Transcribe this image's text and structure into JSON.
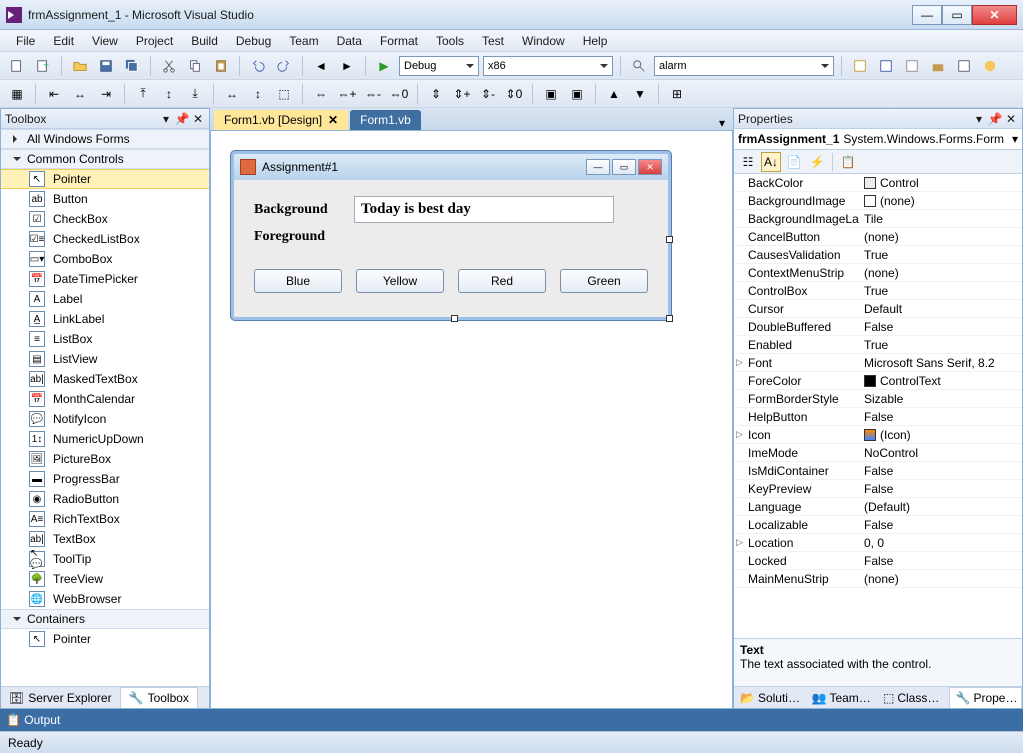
{
  "window": {
    "title": "frmAssignment_1 - Microsoft Visual Studio"
  },
  "menu": [
    "File",
    "Edit",
    "View",
    "Project",
    "Build",
    "Debug",
    "Team",
    "Data",
    "Format",
    "Tools",
    "Test",
    "Window",
    "Help"
  ],
  "toolbar": {
    "config": "Debug",
    "platform": "x86",
    "search": "alarm"
  },
  "toolbox": {
    "title": "Toolbox",
    "groups": {
      "allforms": "All Windows Forms",
      "common": "Common Controls",
      "containers": "Containers"
    },
    "common_items": [
      "Pointer",
      "Button",
      "CheckBox",
      "CheckedListBox",
      "ComboBox",
      "DateTimePicker",
      "Label",
      "LinkLabel",
      "ListBox",
      "ListView",
      "MaskedTextBox",
      "MonthCalendar",
      "NotifyIcon",
      "NumericUpDown",
      "PictureBox",
      "ProgressBar",
      "RadioButton",
      "RichTextBox",
      "TextBox",
      "ToolTip",
      "TreeView",
      "WebBrowser"
    ],
    "container_items": [
      "Pointer"
    ],
    "bottom_tabs": {
      "server": "Server Explorer",
      "toolbox": "Toolbox"
    }
  },
  "docs": {
    "tab1": "Form1.vb [Design]",
    "tab2": "Form1.vb"
  },
  "form": {
    "title": "Assignment#1",
    "label_bg": "Background",
    "label_fg": "Foreground",
    "textbox": "Today is best day",
    "buttons": [
      "Blue",
      "Yellow",
      "Red",
      "Green"
    ]
  },
  "properties": {
    "title": "Properties",
    "selected_name": "frmAssignment_1",
    "selected_type": "System.Windows.Forms.Form",
    "rows": [
      {
        "name": "BackColor",
        "value": "Control",
        "swatch": "#ececec"
      },
      {
        "name": "BackgroundImage",
        "value": "(none)",
        "swatch": "#ffffff"
      },
      {
        "name": "BackgroundImageLa",
        "value": "Tile"
      },
      {
        "name": "CancelButton",
        "value": "(none)"
      },
      {
        "name": "CausesValidation",
        "value": "True"
      },
      {
        "name": "ContextMenuStrip",
        "value": "(none)"
      },
      {
        "name": "ControlBox",
        "value": "True"
      },
      {
        "name": "Cursor",
        "value": "Default"
      },
      {
        "name": "DoubleBuffered",
        "value": "False"
      },
      {
        "name": "Enabled",
        "value": "True"
      },
      {
        "name": "Font",
        "value": "Microsoft Sans Serif, 8.2",
        "exp": true
      },
      {
        "name": "ForeColor",
        "value": "ControlText",
        "swatch": "#000000"
      },
      {
        "name": "FormBorderStyle",
        "value": "Sizable"
      },
      {
        "name": "HelpButton",
        "value": "False"
      },
      {
        "name": "Icon",
        "value": "(Icon)",
        "iconswatch": true,
        "exp": true
      },
      {
        "name": "ImeMode",
        "value": "NoControl"
      },
      {
        "name": "IsMdiContainer",
        "value": "False"
      },
      {
        "name": "KeyPreview",
        "value": "False"
      },
      {
        "name": "Language",
        "value": "(Default)"
      },
      {
        "name": "Localizable",
        "value": "False"
      },
      {
        "name": "Location",
        "value": "0, 0",
        "exp": true
      },
      {
        "name": "Locked",
        "value": "False"
      },
      {
        "name": "MainMenuStrip",
        "value": "(none)"
      }
    ],
    "desc_title": "Text",
    "desc_text": "The text associated with the control.",
    "bottom_tabs": [
      "Soluti…",
      "Team…",
      "Class…",
      "Prope…"
    ]
  },
  "output": {
    "label": "Output"
  },
  "status": {
    "text": "Ready"
  }
}
